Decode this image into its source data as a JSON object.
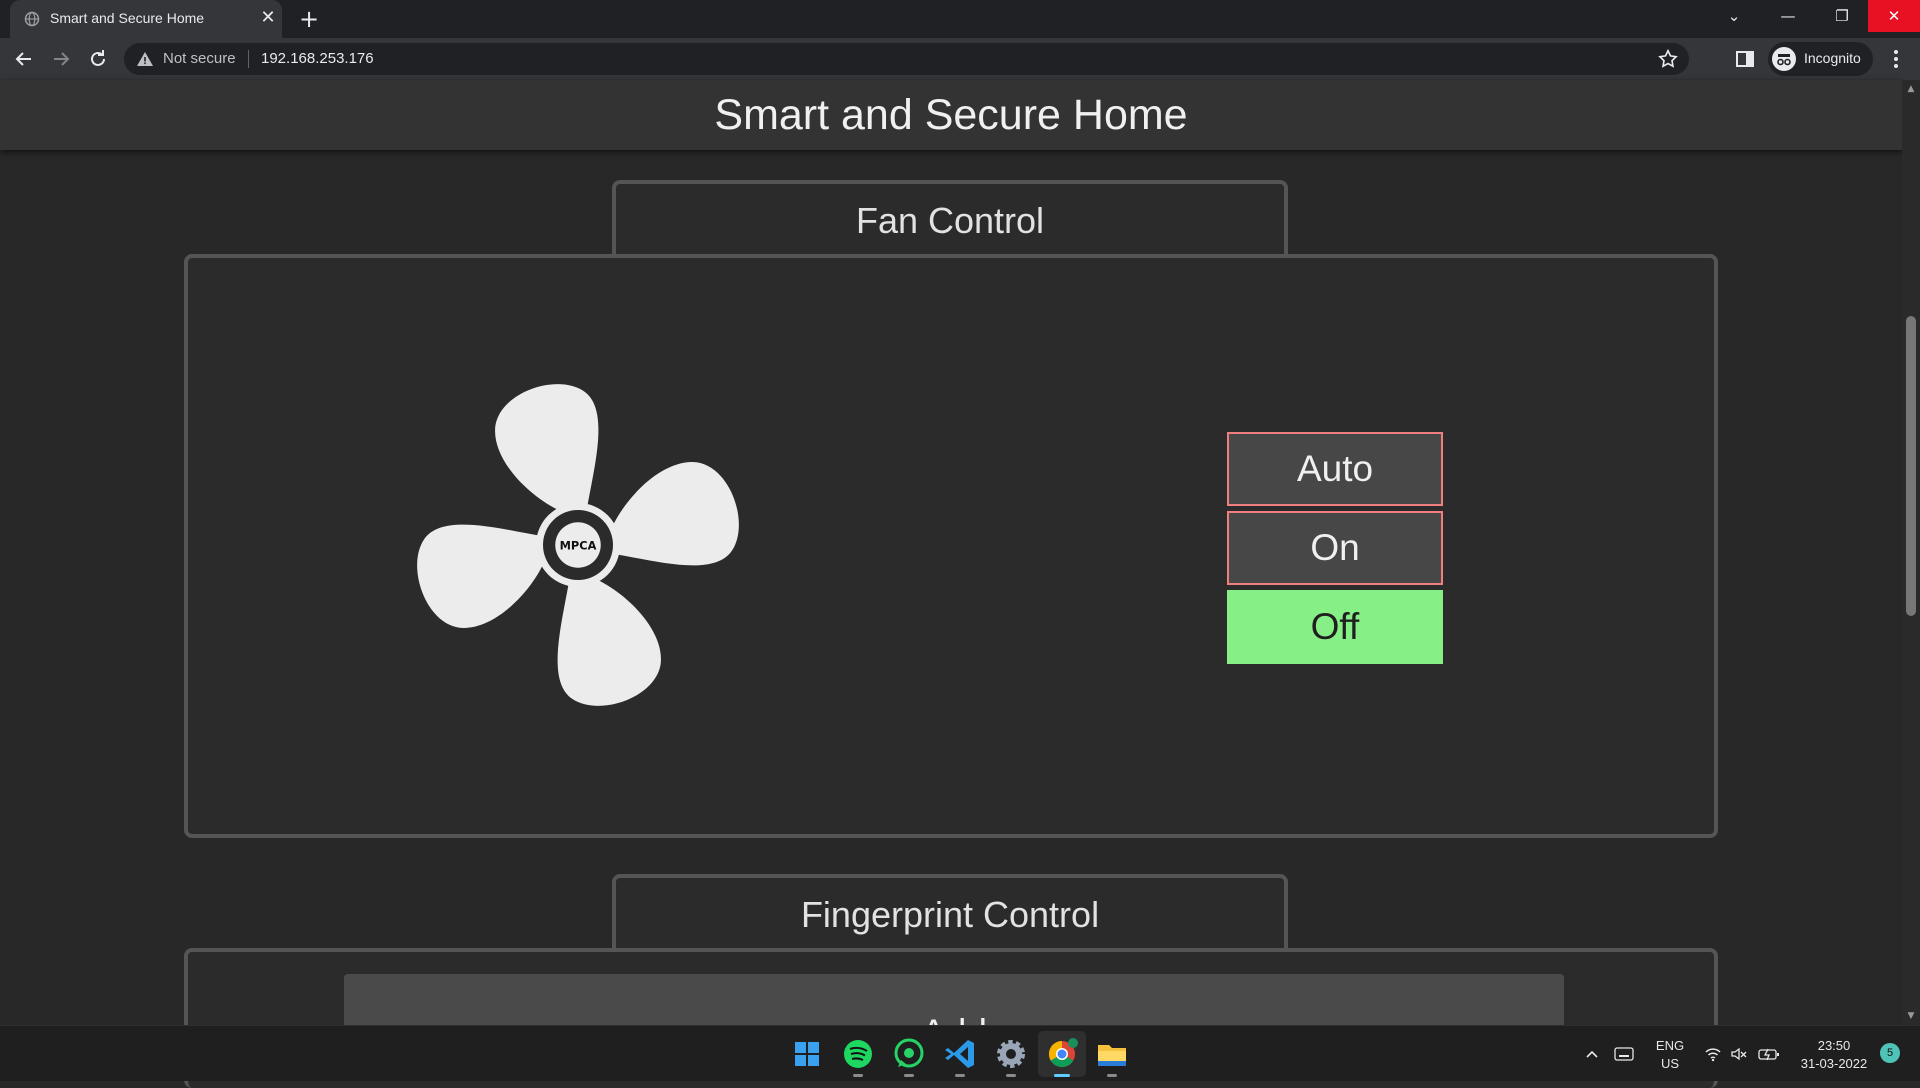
{
  "browser": {
    "tab_title": "Smart and Secure Home",
    "tab_close": "✕",
    "new_tab": "+",
    "security_label": "Not secure",
    "url": "192.168.253.176",
    "profile_label": "Incognito",
    "icons": [
      "globe-icon",
      "back-icon",
      "forward-icon",
      "reload-icon",
      "warning-icon",
      "star-icon",
      "side-panel-icon",
      "incognito-icon",
      "menu-icon"
    ]
  },
  "page": {
    "title": "Smart and Secure Home",
    "fan_section": {
      "title": "Fan Control",
      "fan_hub_text": "MPCA",
      "buttons": [
        {
          "label": "Auto",
          "active": false
        },
        {
          "label": "On",
          "active": false
        },
        {
          "label": "Off",
          "active": true
        }
      ]
    },
    "fingerprint_section": {
      "title": "Fingerprint Control",
      "button_label": "Add"
    }
  },
  "colors": {
    "background": "#282828",
    "header": "#333333",
    "active_button": "#86ef86",
    "idle_button_border": "#f08080",
    "panel_border": "#555555"
  },
  "taskbar": {
    "apps": [
      "start-icon",
      "spotify-icon",
      "whatsapp-icon",
      "vscode-icon",
      "settings-icon",
      "chrome-icon",
      "file-explorer-icon"
    ],
    "language_line1": "ENG",
    "language_line2": "US",
    "time": "23:50",
    "date": "31-03-2022",
    "notification_count": "5"
  }
}
